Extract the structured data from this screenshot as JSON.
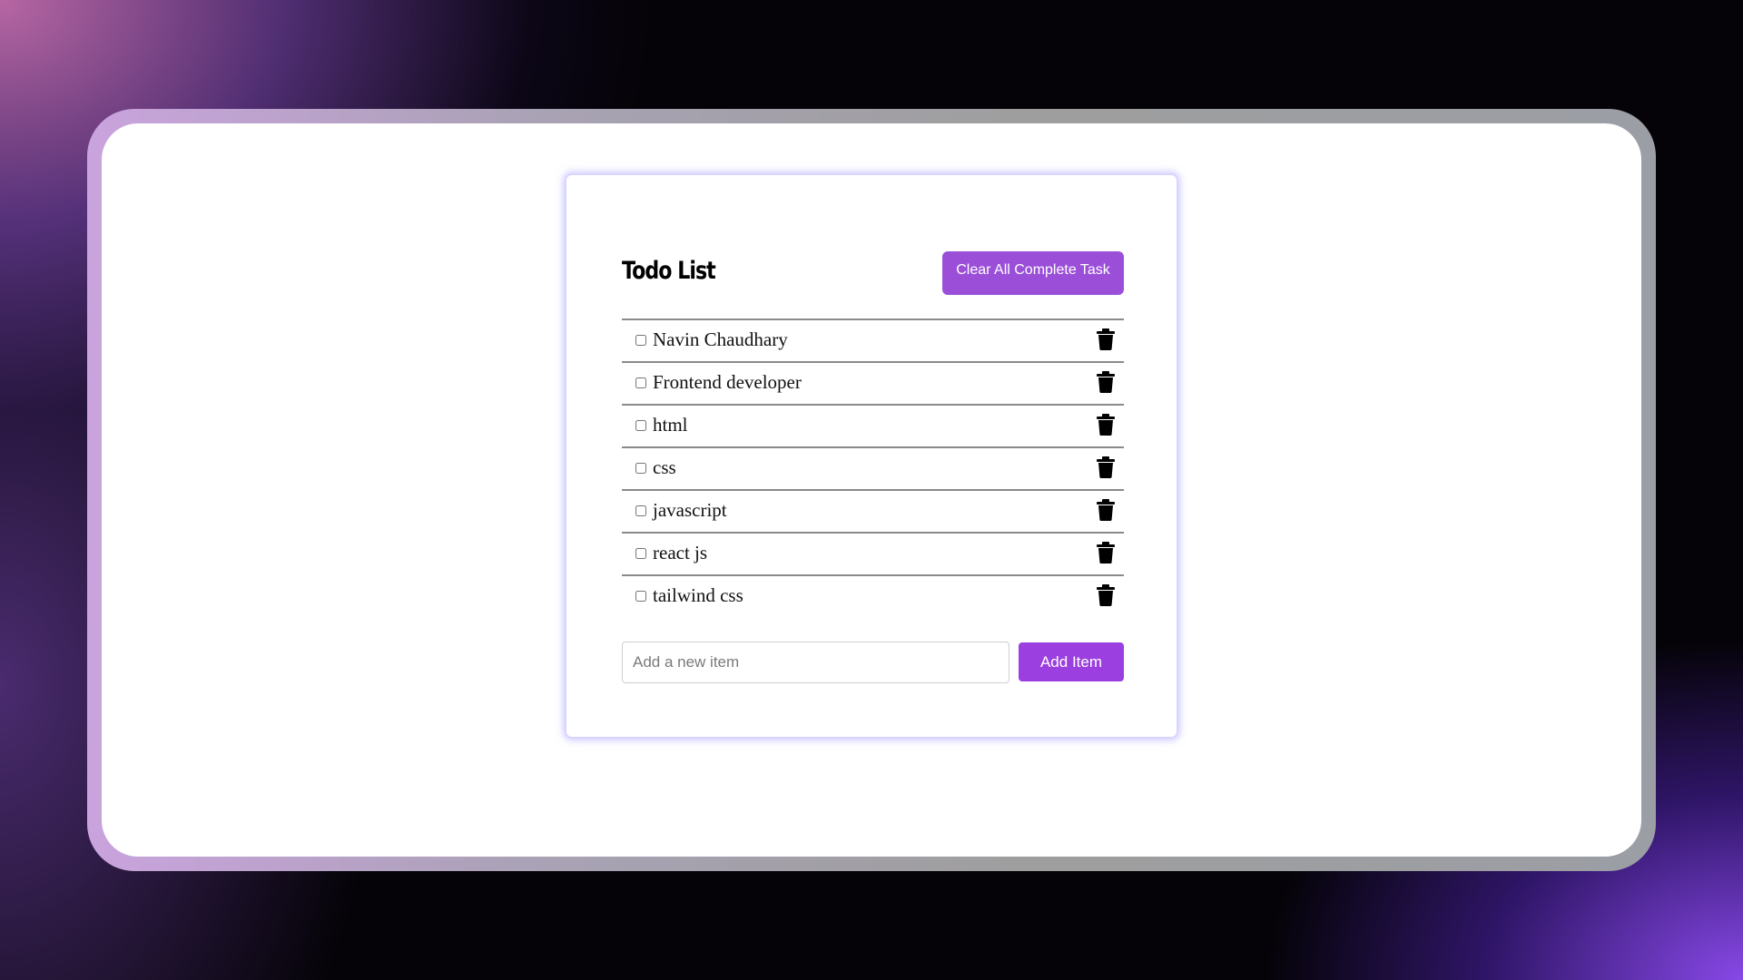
{
  "app": {
    "title": "Todo List",
    "clear_button_label": "Clear All Complete Task"
  },
  "todos": [
    {
      "label": "Navin Chaudhary",
      "completed": false,
      "delete_icon": "trash-icon"
    },
    {
      "label": "Frontend developer",
      "completed": false,
      "delete_icon": "trash-icon"
    },
    {
      "label": "html",
      "completed": false,
      "delete_icon": "trash-icon"
    },
    {
      "label": "css",
      "completed": false,
      "delete_icon": "trash-icon"
    },
    {
      "label": "javascript",
      "completed": false,
      "delete_icon": "trash-icon"
    },
    {
      "label": "react js",
      "completed": false,
      "delete_icon": "trash-icon"
    },
    {
      "label": "tailwind css",
      "completed": false,
      "delete_icon": "trash-icon"
    }
  ],
  "new_item": {
    "value": "",
    "placeholder": "Add a new item",
    "button_label": "Add Item"
  },
  "colors": {
    "accent": "#9b4fd9",
    "add_button": "#9b3fe0",
    "card_glow": "#d8d6ff",
    "divider": "#8a8a8a"
  }
}
